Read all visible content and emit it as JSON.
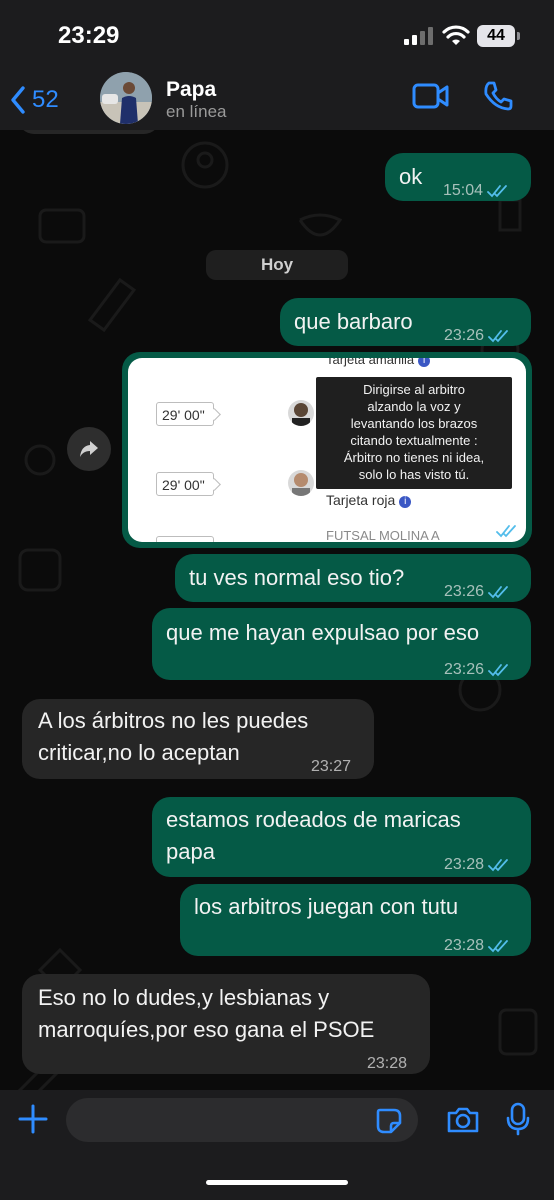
{
  "status_bar": {
    "time": "23:29",
    "battery": "44"
  },
  "header": {
    "back_count": "52",
    "contact_name": "Papa",
    "contact_status": "en línea"
  },
  "chat": {
    "date_separator": "Hoy",
    "messages": [
      {
        "dir": "out",
        "text": "ok",
        "time": "15:04",
        "read": true
      },
      {
        "dir": "out",
        "text": "que barbaro",
        "time": "23:26",
        "read": true
      },
      {
        "dir": "out",
        "type": "image",
        "time": "23:26",
        "read": true
      },
      {
        "dir": "out",
        "text": "tu ves normal eso tio?",
        "time": "23:26",
        "read": true
      },
      {
        "dir": "out",
        "text": "que me hayan expulsao por eso",
        "time": "23:26",
        "read": true
      },
      {
        "dir": "in",
        "text": "A los árbitros no les puedes\ncriticar,no lo aceptan",
        "time": "23:27"
      },
      {
        "dir": "out",
        "text": "estamos rodeados de maricas\npapa",
        "time": "23:28",
        "read": true
      },
      {
        "dir": "out",
        "text": "los arbitros juegan con tutu",
        "time": "23:28",
        "read": true
      },
      {
        "dir": "in",
        "text": "Eso no lo dudes,y lesbianas y\nmarroquíes,por eso gana el PSOE",
        "time": "23:28"
      }
    ]
  },
  "image_message": {
    "top_label": "Tarjeta amarilla",
    "minute_1": "29' 00\"",
    "minute_2": "29' 00\"",
    "red_card_label": "Tarjeta roja",
    "team_label": "FUTSAL MOLINA A",
    "tooltip": "Dirigirse al arbitro\nalzando la voz y\nlevantando los brazos\ncitando textualmente :\nÁrbitro no tienes ni idea,\nsolo lo has visto tú."
  },
  "input_bar": {
    "placeholder": ""
  },
  "colors": {
    "outgoing_bubble": "#055a46",
    "incoming_bubble": "#262626",
    "accent": "#2f8cff",
    "read_ticks": "#53bdeb"
  }
}
